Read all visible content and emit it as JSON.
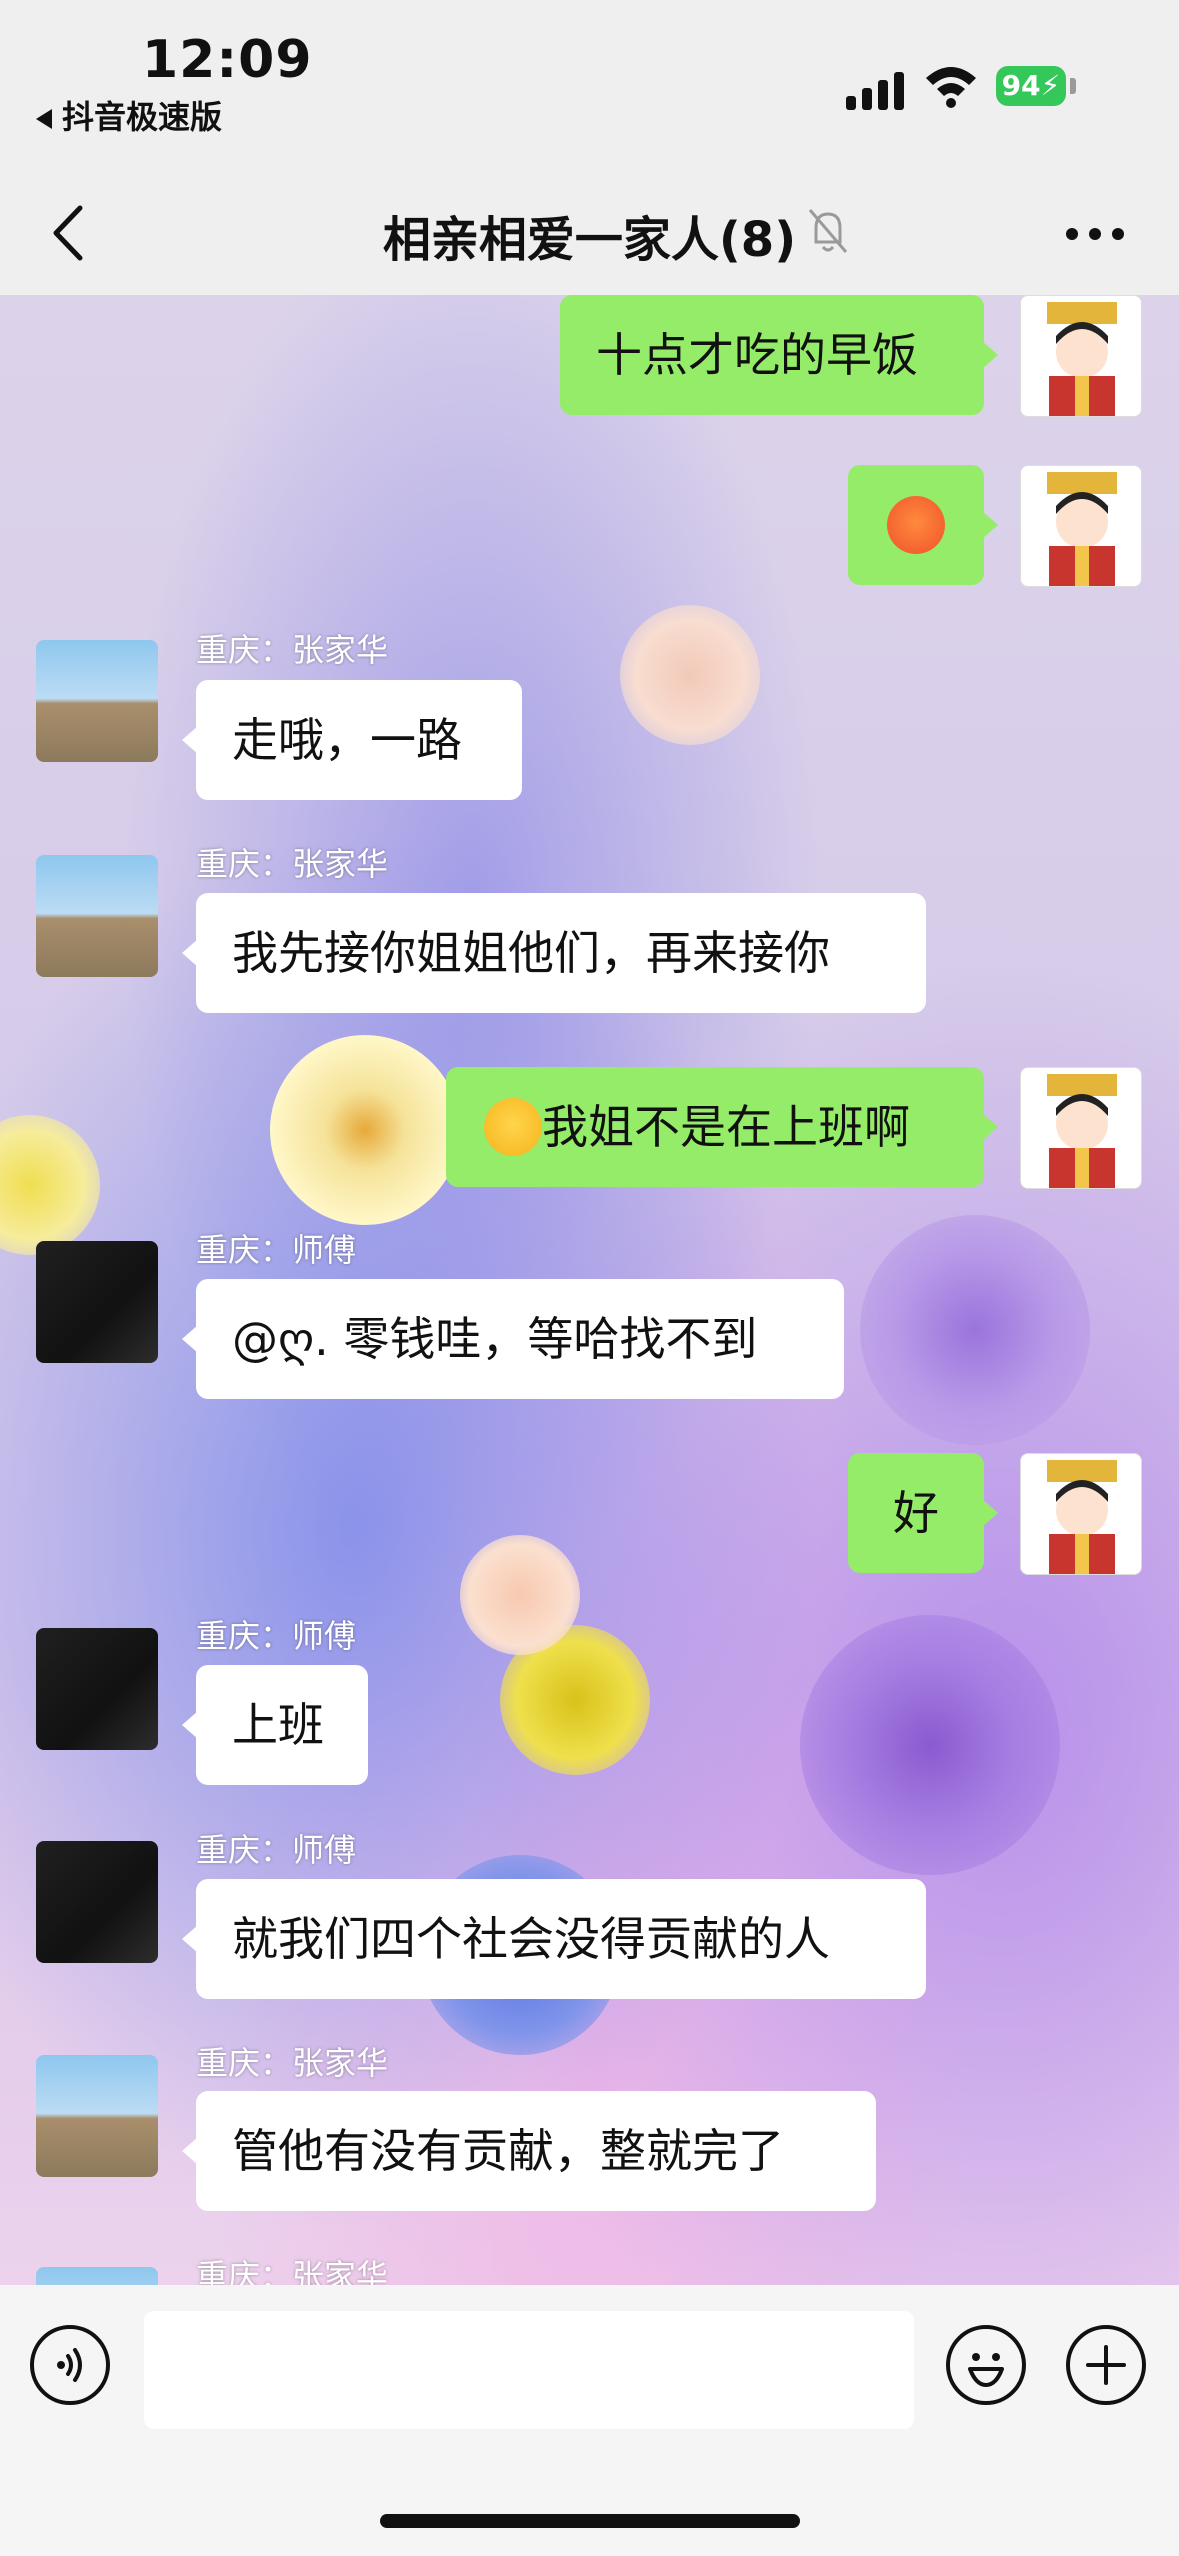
{
  "status_bar": {
    "time": "12:09",
    "back_app": "抖音极速版",
    "battery": "94"
  },
  "nav": {
    "title": "相亲相爱一家人(8)"
  },
  "messages": [
    {
      "side": "out",
      "text": "十点才吃的早饭"
    },
    {
      "side": "out",
      "text": "",
      "emoji": "sweat-face"
    },
    {
      "side": "in",
      "sender": "重庆：张家华",
      "text": "走哦，一路"
    },
    {
      "side": "in",
      "sender": "重庆：张家华",
      "text": "我先接你姐姐他们，再来接你"
    },
    {
      "side": "out",
      "text": "我姐不是在上班啊",
      "emoji": "hand-over-mouth-face"
    },
    {
      "side": "in",
      "sender": "重庆：师傅",
      "text": "@ღ. 零钱哇，等哈找不到"
    },
    {
      "side": "out",
      "text": "好"
    },
    {
      "side": "in",
      "sender": "重庆：师傅",
      "text": "上班"
    },
    {
      "side": "in",
      "sender": "重庆：师傅",
      "text": "就我们四个社会没得贡献的人"
    },
    {
      "side": "in",
      "sender": "重庆：张家华",
      "text": "管他有没有贡献，整就完了"
    },
    {
      "side": "in",
      "sender": "重庆：张家华",
      "text": ""
    }
  ],
  "input": {
    "placeholder": ""
  },
  "colors": {
    "outgoing_bubble": "#95ec69",
    "incoming_bubble": "#ffffff",
    "battery": "#34c759"
  }
}
